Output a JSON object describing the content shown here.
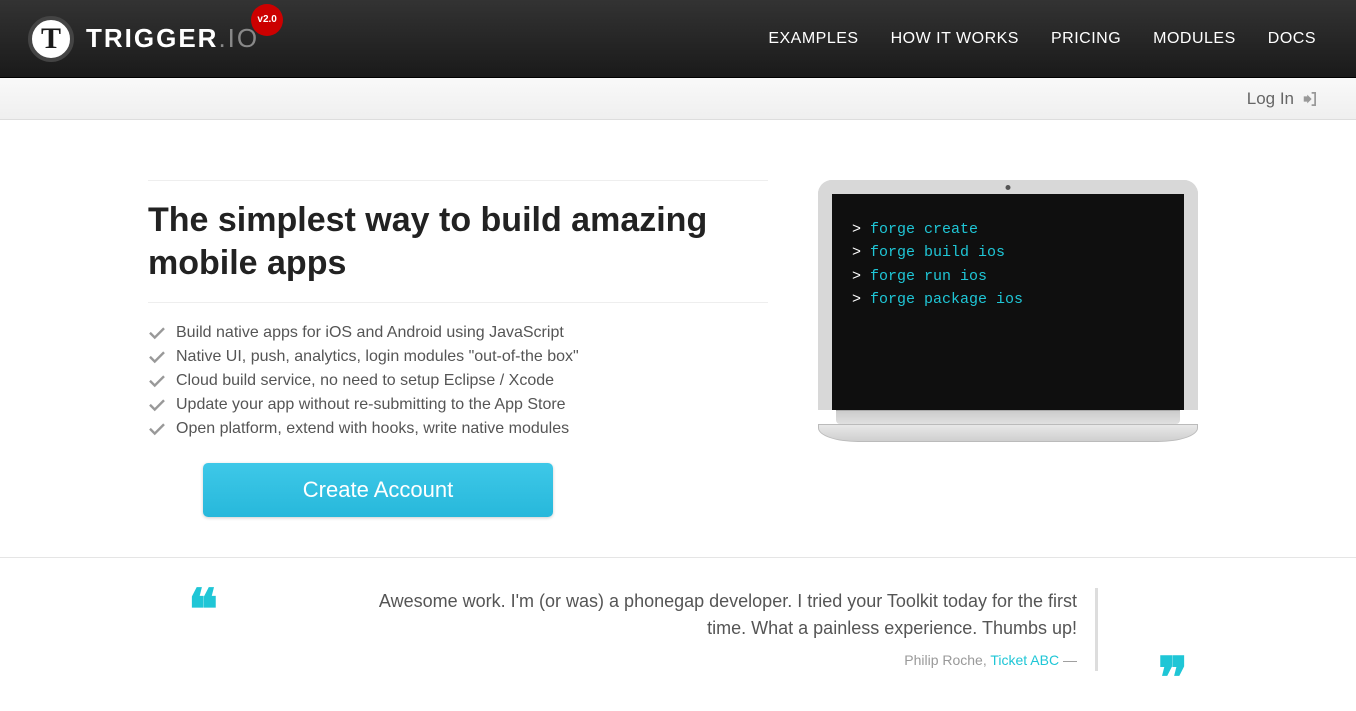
{
  "brand": {
    "name": "TRIGGER",
    "suffix": ".IO",
    "badge": "v2.0",
    "logoLetter": "T"
  },
  "nav": {
    "examples": "EXAMPLES",
    "howitworks": "HOW IT WORKS",
    "pricing": "PRICING",
    "modules": "MODULES",
    "docs": "DOCS"
  },
  "auth": {
    "login": "Log In"
  },
  "hero": {
    "headline": "The simplest way to build amazing mobile apps",
    "features": [
      "Build native apps for iOS and Android using JavaScript",
      "Native UI, push, analytics, login modules \"out-of-the box\"",
      "Cloud build service, no need to setup Eclipse / Xcode",
      "Update your app without re-submitting to the App Store",
      "Open platform, extend with hooks, write native modules"
    ],
    "cta": "Create Account"
  },
  "terminal": {
    "prompt": ">",
    "lines": [
      "forge create",
      "forge build ios",
      "forge run ios",
      "forge package ios"
    ]
  },
  "testimonial": {
    "text": "Awesome work. I'm (or was) a phonegap developer. I tried your Toolkit today for the first time. What a painless experience. Thumbs up!",
    "author": "Philip Roche",
    "sourceLabel": "Ticket ABC",
    "separator": " — "
  }
}
